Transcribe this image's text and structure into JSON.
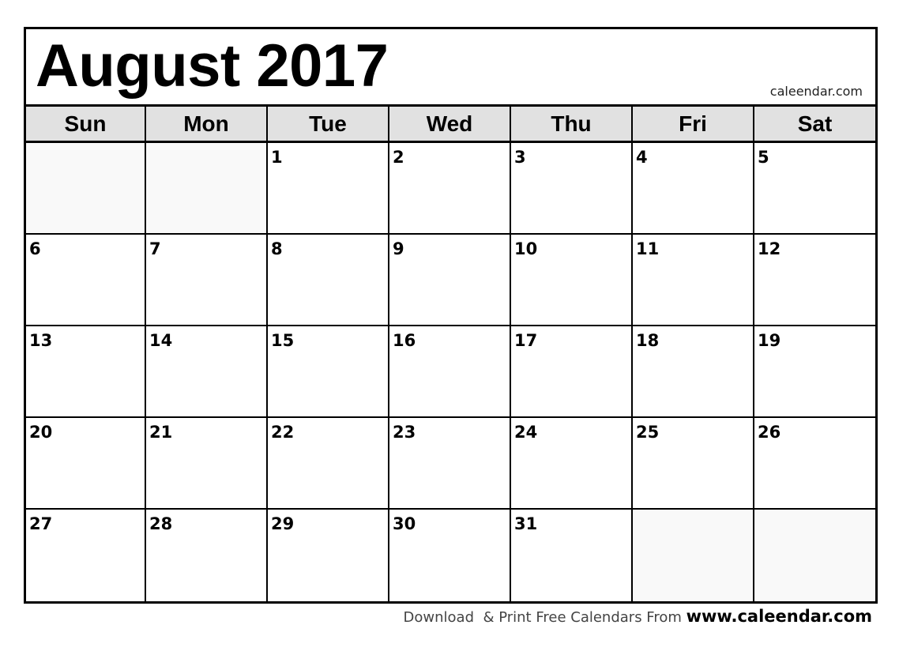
{
  "calendar": {
    "title": "August 2017",
    "brand": "caleendar.com",
    "weekdays": [
      "Sun",
      "Mon",
      "Tue",
      "Wed",
      "Thu",
      "Fri",
      "Sat"
    ],
    "weeks": [
      [
        "",
        "",
        "1",
        "2",
        "3",
        "4",
        "5"
      ],
      [
        "6",
        "7",
        "8",
        "9",
        "10",
        "11",
        "12"
      ],
      [
        "13",
        "14",
        "15",
        "16",
        "17",
        "18",
        "19"
      ],
      [
        "20",
        "21",
        "22",
        "23",
        "24",
        "25",
        "26"
      ],
      [
        "27",
        "28",
        "29",
        "30",
        "31",
        "",
        ""
      ]
    ]
  },
  "footer": {
    "text": "Download  & Print Free Calendars From ",
    "link": "www.caleendar.com"
  },
  "colors": {
    "header_bg": "#e1e1e1",
    "empty_cell_bg": "#f9f9f9",
    "border": "#000000"
  }
}
